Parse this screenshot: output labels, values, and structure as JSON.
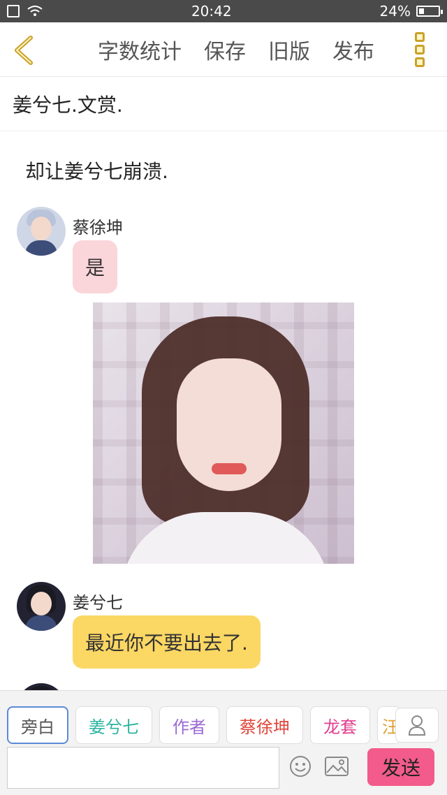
{
  "status_bar": {
    "time": "20:42",
    "battery": "24%",
    "battery_level": 0.24
  },
  "toolbar": {
    "back_icon": "chevron-left-icon",
    "actions": [
      "字数统计",
      "保存",
      "旧版",
      "发布"
    ],
    "menu_icon": "more-vertical-icon",
    "accent_color": "#c9a227"
  },
  "story_title": "姜兮七.文赏.",
  "narration": "却让姜兮七崩溃.",
  "messages": [
    {
      "name": "蔡徐坤",
      "text": "是",
      "bubble_color": "#fad5da"
    },
    {
      "name": "姜兮七",
      "text": "最近你不要出去了.",
      "bubble_color": "#fbd764"
    }
  ],
  "bottom": {
    "chips": [
      {
        "label": "旁白",
        "color": "#555555"
      },
      {
        "label": "姜兮七",
        "color": "#2bb5a0"
      },
      {
        "label": "作者",
        "color": "#9b6ad6"
      },
      {
        "label": "蔡徐坤",
        "color": "#e0463b"
      },
      {
        "label": "龙套",
        "color": "#e04090"
      },
      {
        "label": "汪",
        "color": "#e0a030"
      }
    ],
    "send_label": "发送",
    "send_color": "#f25b8b"
  }
}
